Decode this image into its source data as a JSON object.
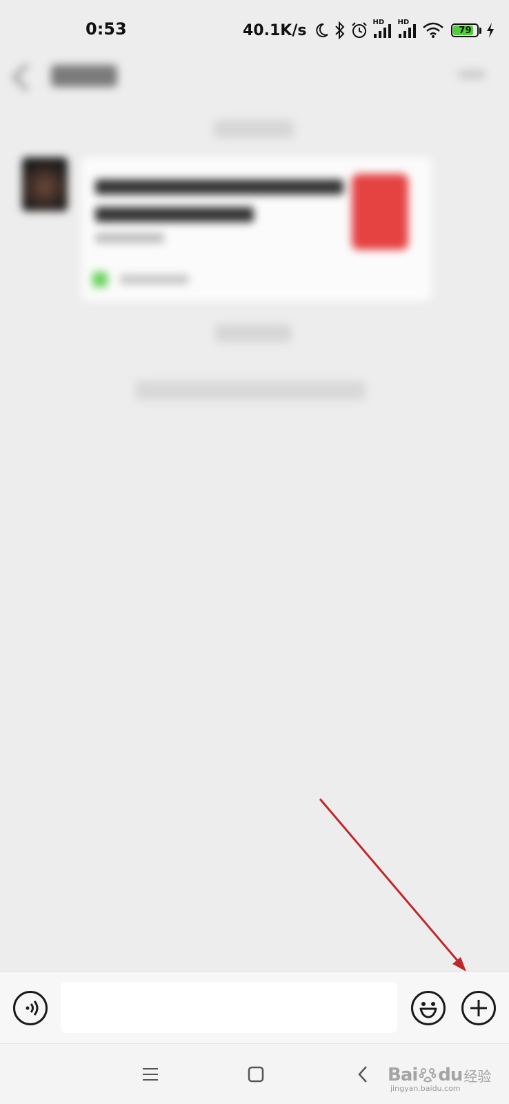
{
  "status_bar": {
    "time": "0:53",
    "net_speed": "40.1K/s",
    "signal_1_label": "HD",
    "signal_2_label": "HD",
    "battery_level": "79",
    "battery_percent": 79,
    "icons": [
      "moon-icon",
      "bluetooth-icon",
      "alarm-icon",
      "signal-icon",
      "signal-icon",
      "wifi-icon",
      "battery-icon",
      "charging-icon"
    ]
  },
  "chat": {
    "blurred": true
  },
  "input_bar": {
    "text_value": "",
    "icons": [
      "voice-icon",
      "emoji-icon",
      "plus-icon"
    ]
  },
  "nav_bar": {
    "icons": [
      "menu-icon",
      "home-icon",
      "back-icon"
    ]
  },
  "watermark": {
    "brand": "Bai",
    "brand_mid": "du",
    "suffix": "经验",
    "url": "jingyan.baidu.com"
  },
  "colors": {
    "background": "#ededed",
    "input_bar": "#f7f7f7",
    "annotation_arrow": "#c0272d",
    "battery_fill": "#4cd137"
  }
}
